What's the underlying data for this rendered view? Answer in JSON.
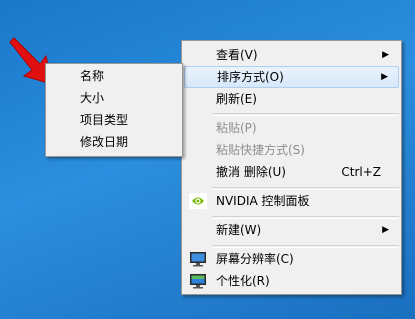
{
  "context_menu": {
    "items": [
      {
        "label": "查看(V)",
        "has_submenu": true
      },
      {
        "label": "排序方式(O)",
        "has_submenu": true,
        "highlighted": true
      },
      {
        "label": "刷新(E)"
      },
      {
        "label": "粘贴(P)",
        "disabled": true
      },
      {
        "label": "粘贴快捷方式(S)",
        "disabled": true
      },
      {
        "label": "撤消 删除(U)",
        "shortcut": "Ctrl+Z"
      },
      {
        "label": "NVIDIA 控制面板",
        "icon": "nvidia-icon"
      },
      {
        "label": "新建(W)",
        "has_submenu": true
      },
      {
        "label": "屏幕分辨率(C)",
        "icon": "screen-resolution-icon"
      },
      {
        "label": "个性化(R)",
        "icon": "personalize-icon"
      }
    ]
  },
  "sort_submenu": {
    "items": [
      {
        "label": "名称"
      },
      {
        "label": "大小"
      },
      {
        "label": "项目类型"
      },
      {
        "label": "修改日期"
      }
    ]
  },
  "submenu_arrow": "▶",
  "colors": {
    "desktop": "#2080d0",
    "menu_bg": "#f0f0f0",
    "highlight": "#d7e8f9",
    "arrow": "#e01010"
  }
}
